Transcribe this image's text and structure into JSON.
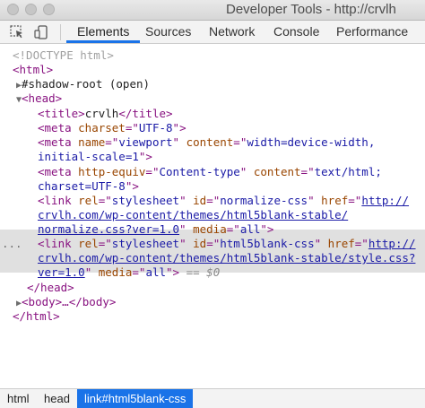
{
  "window": {
    "title": "Developer Tools - http://crvlh"
  },
  "toolbar": {
    "inspect_icon": "inspect-element-icon",
    "device_icon": "device-toolbar-icon",
    "tabs": [
      "Elements",
      "Sources",
      "Network",
      "Console",
      "Performance"
    ],
    "active_tab": "Elements",
    "accent_color": "#1a73e8"
  },
  "dom": {
    "doctype": "<!DOCTYPE html>",
    "html_open": "<html>",
    "shadow_root": "#shadow-root (open)",
    "head_open": "<head>",
    "title_open": "<title>",
    "title_text": "crvlh",
    "title_close": "</title>",
    "meta_charset": {
      "name": "charset",
      "value": "UTF-8"
    },
    "meta_viewport": {
      "attr1": "name",
      "val1": "viewport",
      "attr2": "content",
      "val2_line1": "width=device-width,",
      "val2_line2": "initial-scale=1"
    },
    "meta_http": {
      "attr1": "http-equiv",
      "val1": "Content-type",
      "attr2": "content",
      "val2_line1": "text/html;",
      "val2_line2": "charset=UTF-8"
    },
    "link_normalize": {
      "rel": "stylesheet",
      "id": "normalize-css",
      "href_line1": "http://",
      "href_line2": "crvlh.com/wp-content/themes/html5blank-stable/",
      "href_line3": "normalize.css?ver=1.0",
      "media": "all"
    },
    "link_html5": {
      "rel": "stylesheet",
      "id": "html5blank-css",
      "href_line1": "http://",
      "href_line2": "crvlh.com/wp-content/themes/html5blank-stable/style.css?",
      "href_line3": "ver=1.0",
      "media": "all"
    },
    "selected_marker": "== $0",
    "ellipsis": "...",
    "head_close": "</head>",
    "body_collapsed": "<body>…</body>",
    "html_close": "</html>"
  },
  "breadcrumbs": [
    "html",
    "head",
    "link#html5blank-css"
  ]
}
